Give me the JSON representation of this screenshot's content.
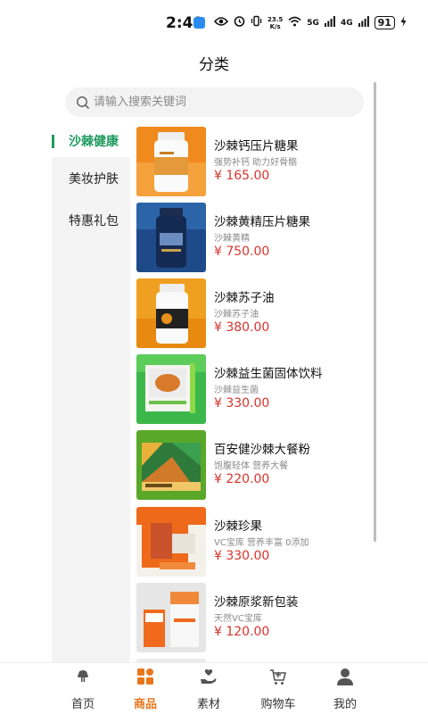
{
  "status_bar": {
    "time": "2:49",
    "speed": "23.5\nK/s",
    "net1": "5G",
    "net2": "4G",
    "battery": "91"
  },
  "header": {
    "title": "分类"
  },
  "search": {
    "placeholder": "请输入搜索关键词"
  },
  "sidebar": {
    "items": [
      {
        "label": "沙棘健康",
        "active": true
      },
      {
        "label": "美妆护肤",
        "active": false
      },
      {
        "label": "特惠礼包",
        "active": false
      }
    ]
  },
  "products": [
    {
      "name": "沙棘钙压片糖果",
      "desc": "强势补钙 助力好骨骼",
      "price": "¥ 165.00"
    },
    {
      "name": "沙棘黄精压片糖果",
      "desc": "沙棘黄精",
      "price": "¥ 750.00"
    },
    {
      "name": "沙棘苏子油",
      "desc": "沙棘苏子油",
      "price": "¥ 380.00"
    },
    {
      "name": "沙棘益生菌固体饮料",
      "desc": "沙棘益生菌",
      "price": "¥ 330.00"
    },
    {
      "name": "百安健沙棘大餐粉",
      "desc": "饱腹轻体 营养大餐",
      "price": "¥ 220.00"
    },
    {
      "name": "沙棘珍果",
      "desc": "VC宝库 营养丰富 0添加",
      "price": "¥ 330.00"
    },
    {
      "name": "沙棘原浆新包装",
      "desc": "天然VC宝库",
      "price": "¥ 120.00"
    }
  ],
  "tabs": [
    {
      "label": "首页",
      "icon": "home-icon",
      "active": false
    },
    {
      "label": "商品",
      "icon": "category-grid-icon",
      "active": true
    },
    {
      "label": "素材",
      "icon": "material-hand-icon",
      "active": false
    },
    {
      "label": "购物车",
      "icon": "cart-icon",
      "active": false
    },
    {
      "label": "我的",
      "icon": "user-icon",
      "active": false
    }
  ],
  "colors": {
    "accent_green": "#1e9a5c",
    "price_red": "#d8342c",
    "tab_active_orange": "#e8771c"
  }
}
